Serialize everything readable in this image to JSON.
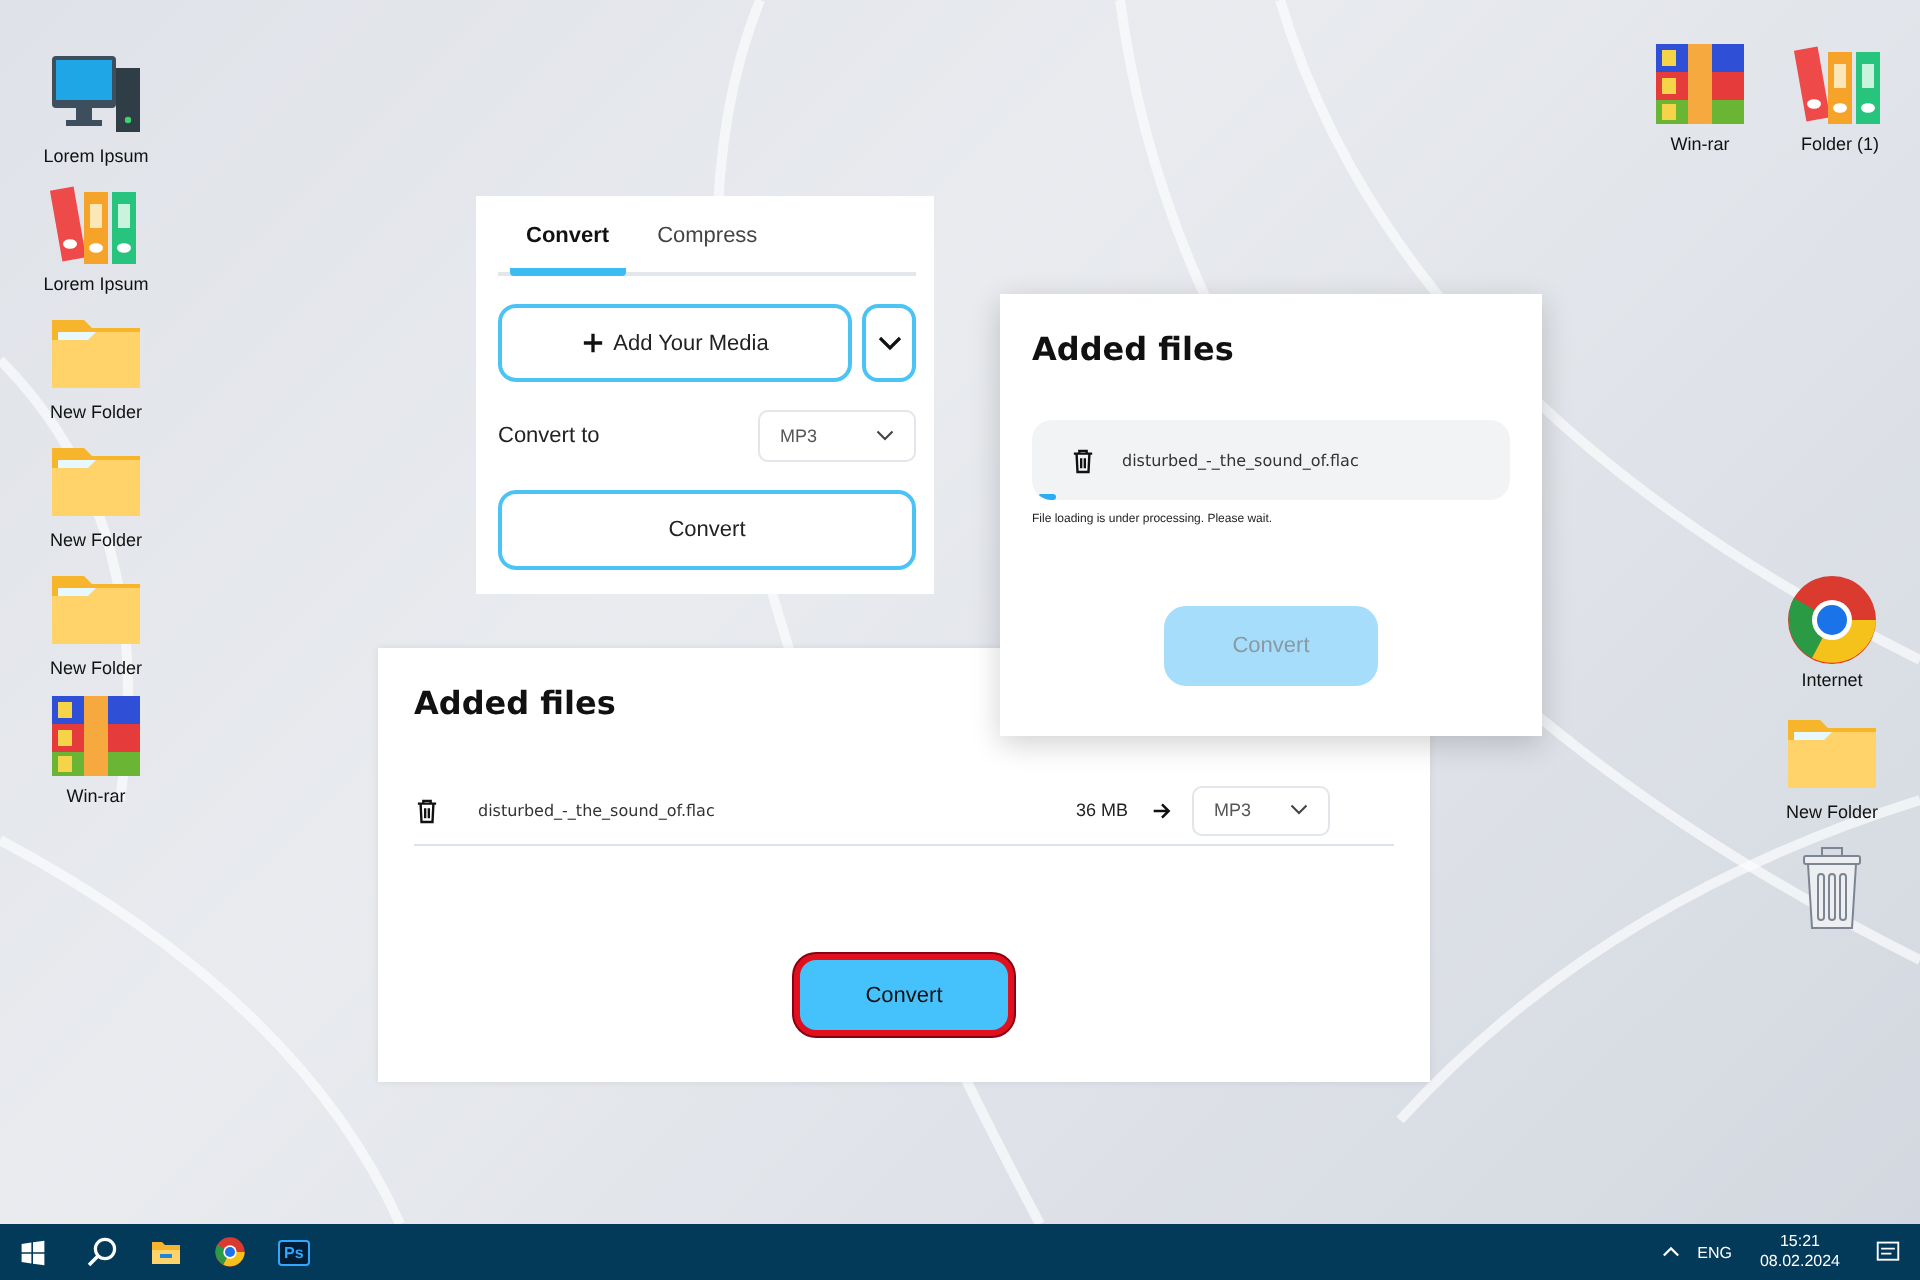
{
  "desktop_left": [
    {
      "kind": "computer",
      "label": "Lorem Ipsum"
    },
    {
      "kind": "binders",
      "label": "Lorem Ipsum"
    },
    {
      "kind": "folder",
      "label": "New Folder"
    },
    {
      "kind": "folder",
      "label": "New Folder"
    },
    {
      "kind": "folder",
      "label": "New Folder"
    },
    {
      "kind": "archive",
      "label": "Win-rar"
    }
  ],
  "desktop_top_right": [
    {
      "kind": "archive",
      "label": "Win-rar"
    },
    {
      "kind": "binders",
      "label": "Folder (1)"
    }
  ],
  "desktop_right": [
    {
      "kind": "browser",
      "label": "Internet"
    },
    {
      "kind": "folder",
      "label": "New Folder"
    },
    {
      "kind": "trash"
    }
  ],
  "converter_panel": {
    "tabs": [
      {
        "label": "Convert",
        "selected": true
      },
      {
        "label": "Compress",
        "selected": false
      }
    ],
    "add_button": "Add Your Media",
    "convert_to_label": "Convert to",
    "format": "MP3",
    "convert_button": "Convert"
  },
  "processing_panel": {
    "title": "Added files",
    "file_name": "disturbed_-_the_sound_of.flac",
    "level": 0.04,
    "note": "File loading is under processing. Please wait.",
    "convert_button": "Convert",
    "disabled": true
  },
  "added_files_panel": {
    "title": "Added files",
    "files": [
      {
        "name": "disturbed_-_the_sound_of.flac",
        "size": "36 MB",
        "format": "MP3"
      }
    ],
    "convert_button": "Convert",
    "highlighted": true
  },
  "taskbar": {
    "apps": [
      {
        "kind": "start"
      },
      {
        "kind": "search"
      },
      {
        "kind": "explorer"
      },
      {
        "kind": "browser"
      },
      {
        "kind": "photoshop",
        "label": "Ps"
      }
    ],
    "language": "ENG",
    "time": "15:21",
    "date": "08.02.2024"
  }
}
